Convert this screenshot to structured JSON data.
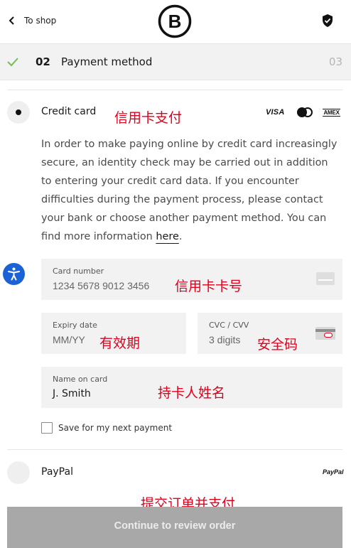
{
  "header": {
    "back_label": "To shop",
    "logo_letter": "B"
  },
  "stepbar": {
    "step_number": "02",
    "step_title": "Payment method",
    "next_step_number": "03"
  },
  "credit_card": {
    "label": "Credit card",
    "note_cn": "信用卡支付",
    "brands": [
      "VISA",
      "mastercard-icon",
      "AMEX"
    ],
    "visa_text": "VISA",
    "amex_text": "AMEX",
    "info_text": "In order to make paying online by credit card increasingly secure, an identity check may be carried out in addition to entering your credit card data. If you encounter difficulties during the payment process, please contact your bank or choose another payment method. You can find more information ",
    "info_link": "here",
    "info_end": "."
  },
  "fields": {
    "card_number": {
      "label": "Card number",
      "placeholder": "1234 5678 9012 3456",
      "note_cn": "信用卡卡号"
    },
    "expiry": {
      "label": "Expiry date",
      "placeholder": "MM/YY",
      "note_cn": "有效期"
    },
    "cvc": {
      "label": "CVC / CVV",
      "placeholder": "3 digits",
      "note_cn": "安全码"
    },
    "name": {
      "label": "Name on card",
      "placeholder": "J. Smith",
      "note_cn": "持卡人姓名"
    }
  },
  "save_checkbox": {
    "label": "Save for my next payment",
    "checked": false
  },
  "paypal": {
    "label": "PayPal",
    "logo_text": "PayPal"
  },
  "submit": {
    "note_cn": "提交订单并支付",
    "label": "Continue to review order"
  },
  "colors": {
    "accent_check": "#6fbf57",
    "annotation_red": "#e0001b",
    "a11y_blue": "#1a62d6",
    "button_gray": "#a8a8a8"
  }
}
